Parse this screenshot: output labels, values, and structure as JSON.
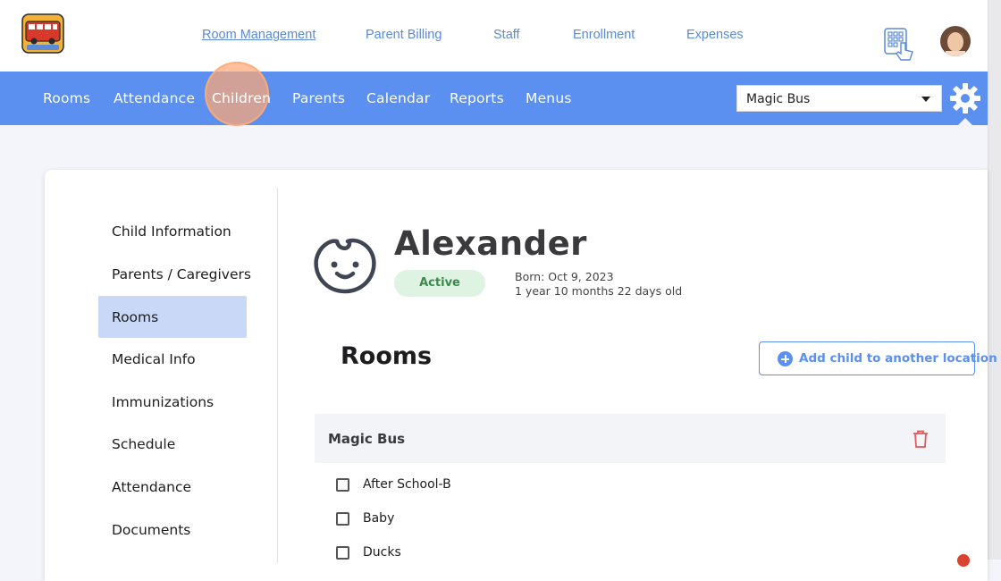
{
  "top_nav": {
    "links": [
      {
        "label": "Room Management",
        "current": true
      },
      {
        "label": "Parent Billing"
      },
      {
        "label": "Staff"
      },
      {
        "label": "Enrollment"
      },
      {
        "label": "Expenses"
      }
    ],
    "logo_text": "MAGIC BUS"
  },
  "main_nav": {
    "items": [
      {
        "label": "Rooms"
      },
      {
        "label": "Attendance"
      },
      {
        "label": "Children",
        "highlighted": true
      },
      {
        "label": "Parents"
      },
      {
        "label": "Calendar"
      },
      {
        "label": "Reports"
      },
      {
        "label": "Menus"
      }
    ],
    "location_select": {
      "selected": "Magic Bus"
    },
    "accent_color": "#5b8ff0"
  },
  "sidebar": {
    "items": [
      {
        "label": "Child Information"
      },
      {
        "label": "Parents / Caregivers"
      },
      {
        "label": "Rooms",
        "active": true
      },
      {
        "label": "Medical Info"
      },
      {
        "label": "Immunizations"
      },
      {
        "label": "Schedule"
      },
      {
        "label": "Attendance"
      },
      {
        "label": "Documents"
      }
    ]
  },
  "child": {
    "name": "Alexander",
    "status": "Active",
    "born": "Born: Oct 9, 2023",
    "age": "1 year 10 months 22 days old"
  },
  "rooms_section": {
    "title": "Rooms",
    "add_button": "Add child to another location",
    "location_group": {
      "name": "Magic Bus",
      "rooms": [
        {
          "label": "After School-B",
          "checked": false
        },
        {
          "label": "Baby",
          "checked": false
        },
        {
          "label": "Ducks",
          "checked": false
        }
      ]
    }
  }
}
